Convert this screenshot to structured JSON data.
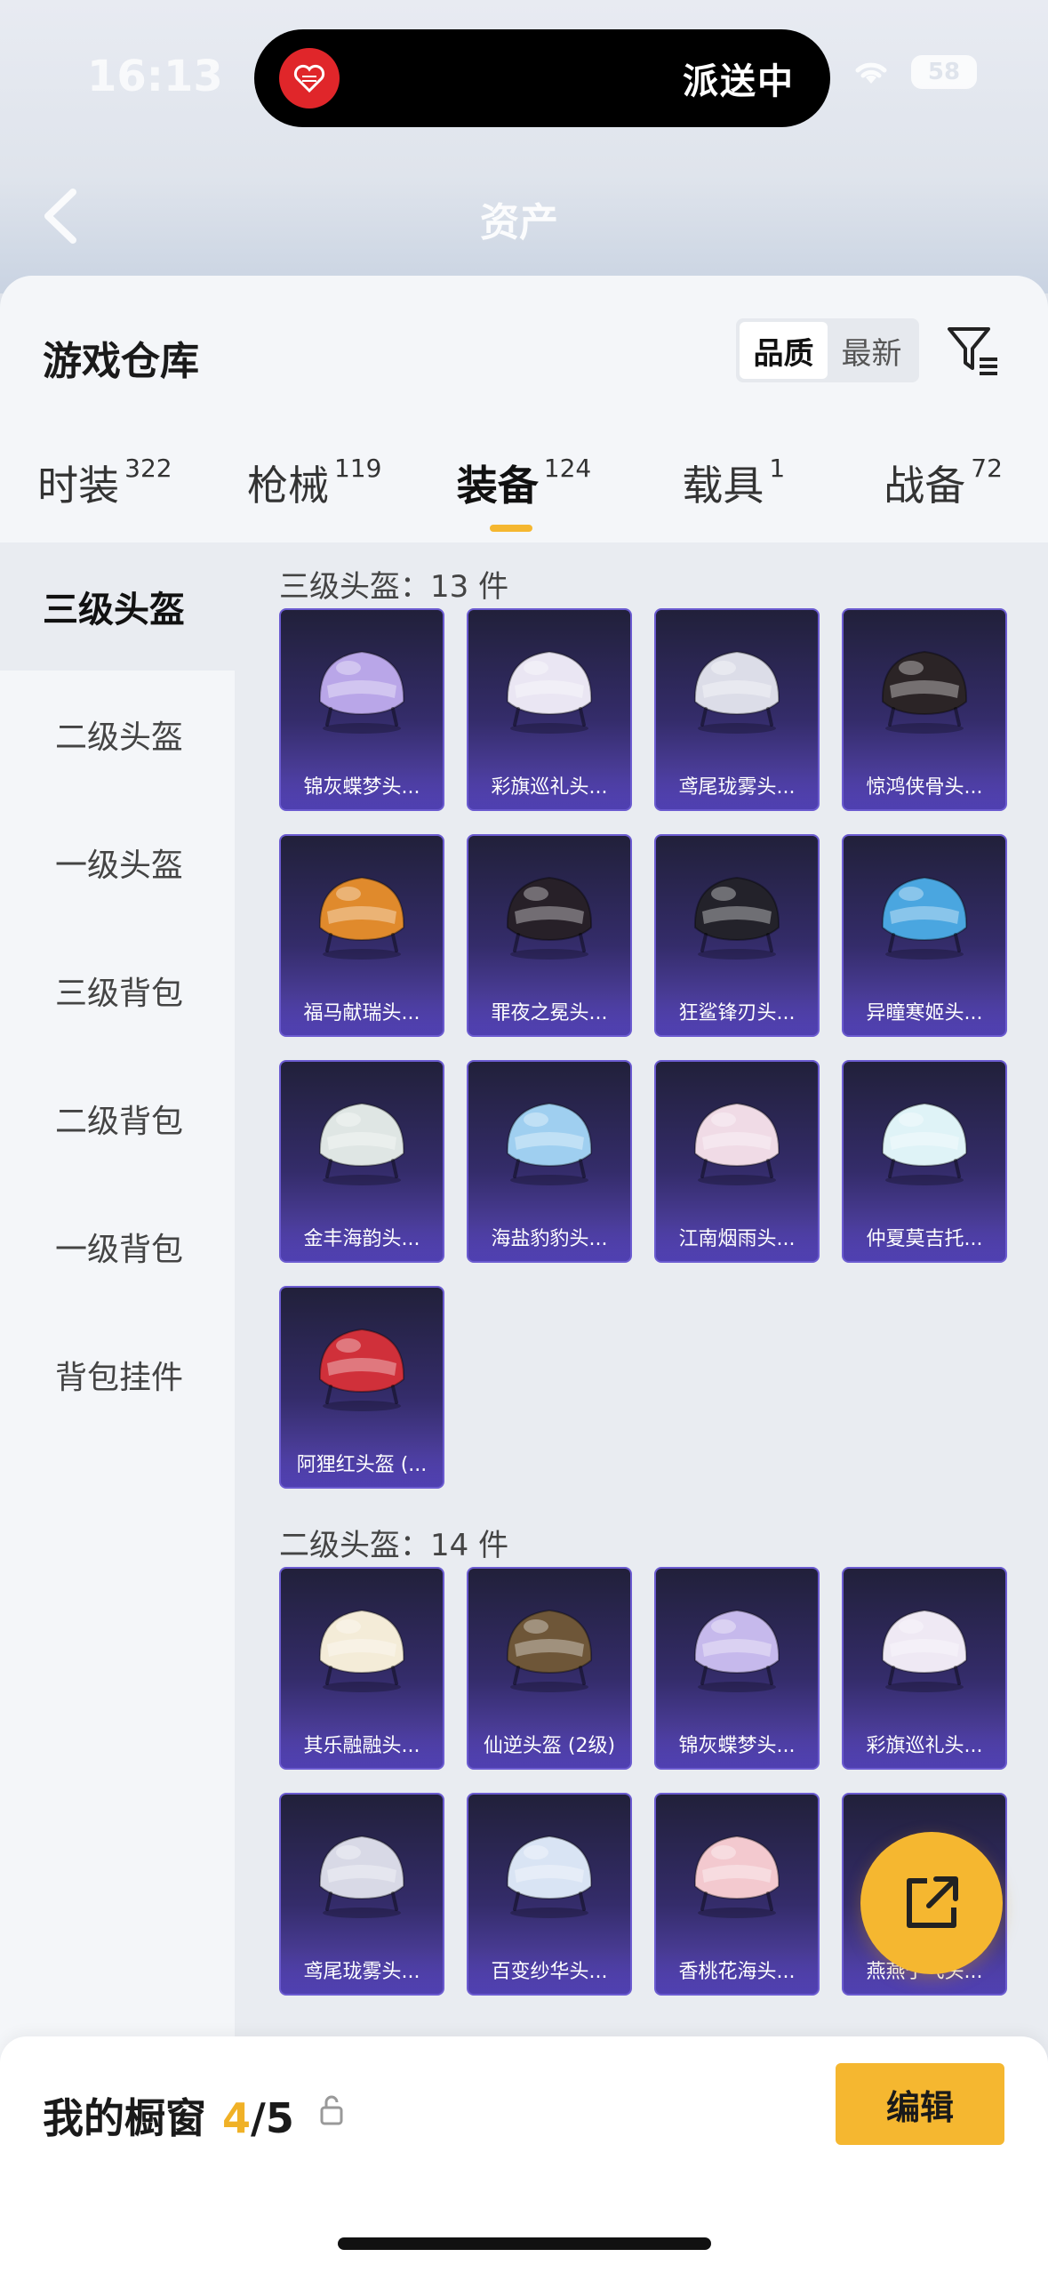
{
  "status": {
    "time": "16:13",
    "battery": "58"
  },
  "island": {
    "text": "派送中"
  },
  "nav": {
    "title": "资产"
  },
  "header": {
    "title": "游戏仓库",
    "sort_options": [
      "品质",
      "最新"
    ]
  },
  "tabs": [
    {
      "label": "时装",
      "count": "322"
    },
    {
      "label": "枪械",
      "count": "119"
    },
    {
      "label": "装备",
      "count": "124"
    },
    {
      "label": "载具",
      "count": "1"
    },
    {
      "label": "战备",
      "count": "72"
    }
  ],
  "categories": [
    "三级头盔",
    "二级头盔",
    "一级头盔",
    "三级背包",
    "二级背包",
    "一级背包",
    "背包挂件"
  ],
  "sections": [
    {
      "title": "三级头盔：13 件",
      "items": [
        {
          "name": "锦灰蝶梦头...",
          "color": "#b9a6e8"
        },
        {
          "name": "彩旗巡礼头...",
          "color": "#eae6f3"
        },
        {
          "name": "鸢尾珑雾头...",
          "color": "#dcdde8"
        },
        {
          "name": "惊鸿侠骨头...",
          "color": "#2b2426"
        },
        {
          "name": "福马献瑞头...",
          "color": "#e08a2c"
        },
        {
          "name": "罪夜之冕头...",
          "color": "#272028"
        },
        {
          "name": "狂鲨锋刃头...",
          "color": "#23222a"
        },
        {
          "name": "异瞳寒姬头...",
          "color": "#4aa6e0"
        },
        {
          "name": "金丰海韵头...",
          "color": "#dfe6e4"
        },
        {
          "name": "海盐豹豹头...",
          "color": "#9fcff0"
        },
        {
          "name": "江南烟雨头...",
          "color": "#f0dbe6"
        },
        {
          "name": "仲夏莫吉托...",
          "color": "#dff3f7"
        },
        {
          "name": "阿狸红头盔 (...",
          "color": "#d0303a"
        }
      ]
    },
    {
      "title": "二级头盔：14 件",
      "items": [
        {
          "name": "其乐融融头...",
          "color": "#f4ecd8"
        },
        {
          "name": "仙逆头盔 (2级)",
          "color": "#6e5638"
        },
        {
          "name": "锦灰蝶梦头...",
          "color": "#c6b9ec"
        },
        {
          "name": "彩旗巡礼头...",
          "color": "#efe9f4"
        },
        {
          "name": "鸢尾珑雾头...",
          "color": "#d8d9e6"
        },
        {
          "name": "百变纱华头...",
          "color": "#d9e4f4"
        },
        {
          "name": "香桃花海头...",
          "color": "#f3c9cf"
        },
        {
          "name": "燕燕于飞头...",
          "color": "#ece8ee"
        }
      ]
    }
  ],
  "showcase": {
    "label": "我的橱窗",
    "count": "4",
    "total": "/5",
    "edit_label": "编辑"
  }
}
